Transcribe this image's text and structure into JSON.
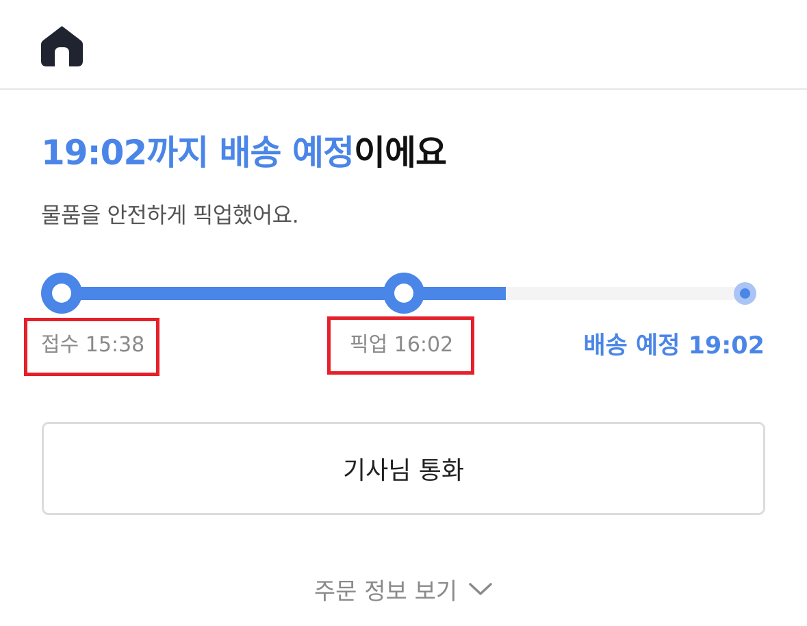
{
  "header": {
    "home_icon": "home-icon"
  },
  "status": {
    "title_accent": "19:02까지 배송 예정",
    "title_rest": "이에요",
    "subtitle": "물품을 안전하게 픽업했어요."
  },
  "progress": {
    "completed_fraction": 0.65,
    "steps": [
      {
        "label": "접수 15:38"
      },
      {
        "label": "픽업 16:02"
      },
      {
        "label": "배송 예정 19:02"
      }
    ]
  },
  "actions": {
    "call_driver_label": "기사님 통화",
    "order_info_label": "주문 정보 보기"
  },
  "colors": {
    "accent": "#4a85e8",
    "highlight": "#e5202a"
  }
}
